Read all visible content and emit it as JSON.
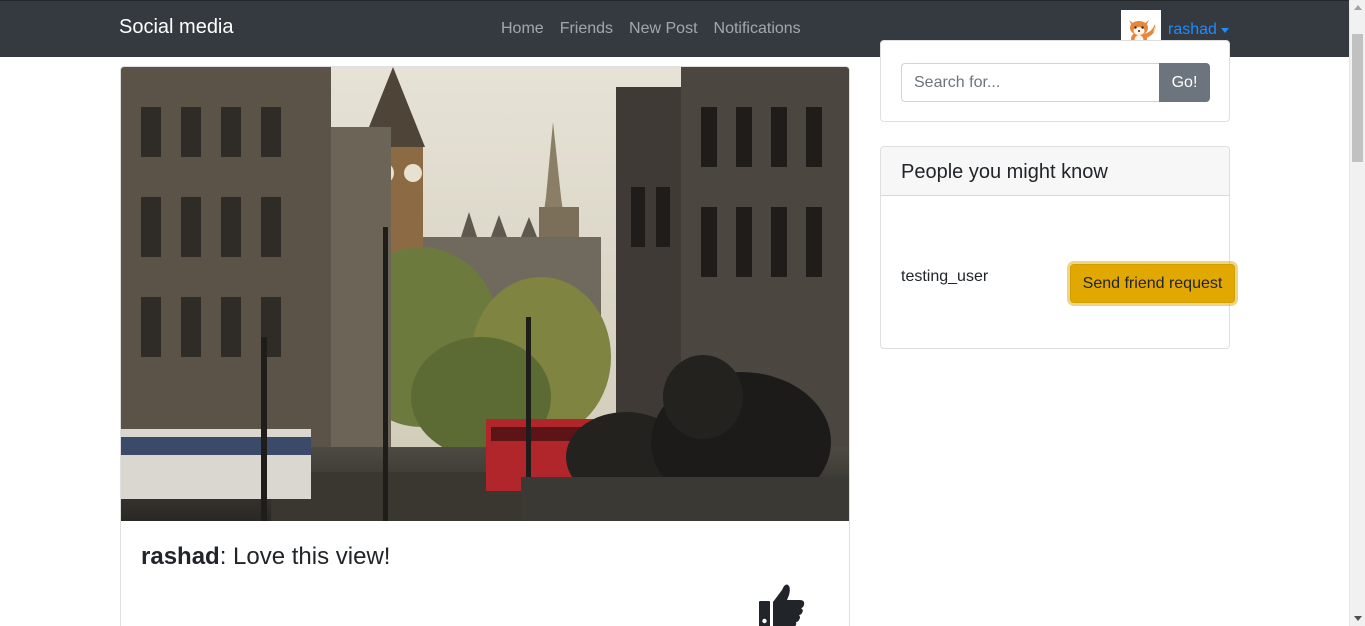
{
  "navbar": {
    "brand": "Social media",
    "links": [
      {
        "label": "Home"
      },
      {
        "label": "Friends"
      },
      {
        "label": "New Post"
      },
      {
        "label": "Notifications"
      }
    ],
    "user": {
      "name": "rashad",
      "avatar_icon": "fox-avatar-icon"
    }
  },
  "post": {
    "author": "rashad",
    "separator": ": ",
    "text": "Love this view!",
    "like_icon": "thumbs-up-icon"
  },
  "search": {
    "placeholder": "Search for...",
    "button_label": "Go!"
  },
  "suggestions": {
    "title": "People you might know",
    "people": [
      {
        "username": "testing_user",
        "action_label": "Send friend request"
      }
    ]
  },
  "colors": {
    "navbar_bg": "#343a40",
    "link_active": "#1e8bff",
    "warning_button": "#e0a800",
    "secondary_button": "#6c757d"
  }
}
